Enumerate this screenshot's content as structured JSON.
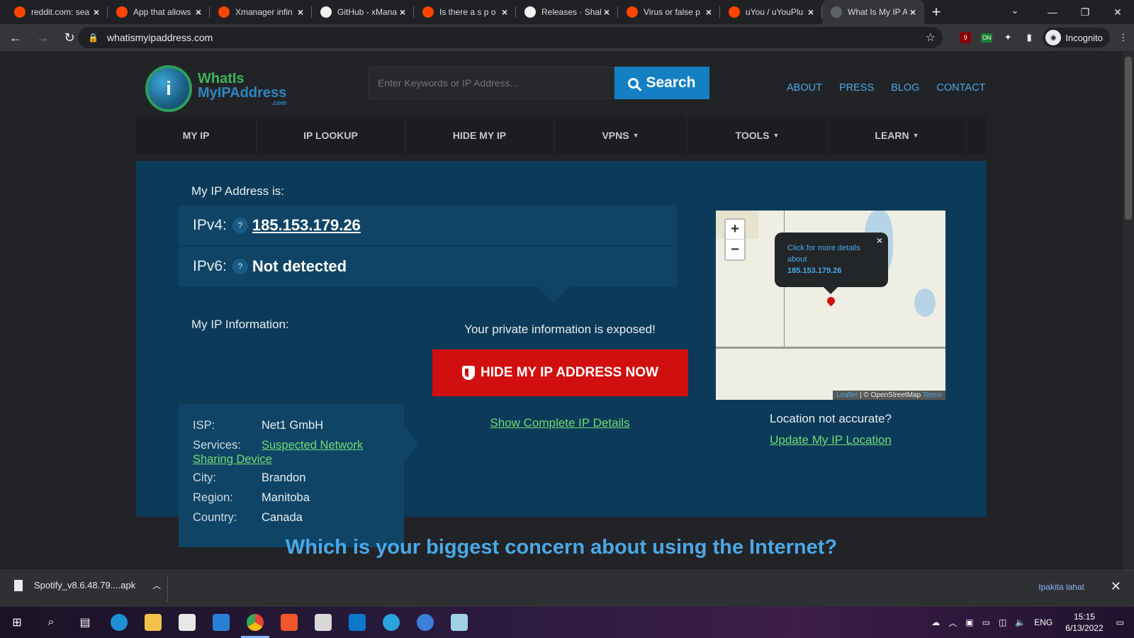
{
  "tabs": [
    {
      "title": "reddit.com: sea",
      "icon": "reddit"
    },
    {
      "title": "App that allows",
      "icon": "reddit"
    },
    {
      "title": "Xmanager infin",
      "icon": "reddit"
    },
    {
      "title": "GitHub - xMana",
      "icon": "github"
    },
    {
      "title": "Is there a s p o",
      "icon": "reddit"
    },
    {
      "title": "Releases · Shab",
      "icon": "github"
    },
    {
      "title": "Virus or false p",
      "icon": "reddit"
    },
    {
      "title": "uYou / uYouPlu",
      "icon": "reddit"
    },
    {
      "title": "What Is My IP A",
      "icon": "globe",
      "active": true
    }
  ],
  "browser": {
    "url": "whatismyipaddress.com",
    "profile": "Incognito",
    "ext_badge_count": "9",
    "ext_on_label": "ON"
  },
  "site": {
    "logo": {
      "line1": "WhatIs",
      "line2": "MyIPAddress",
      "suffix": ".com"
    },
    "search": {
      "placeholder": "Enter Keywords or IP Address...",
      "button": "Search"
    },
    "toplinks": [
      "ABOUT",
      "PRESS",
      "BLOG",
      "CONTACT"
    ],
    "nav": [
      {
        "label": "MY IP",
        "caret": false
      },
      {
        "label": "IP LOOKUP",
        "caret": false
      },
      {
        "label": "HIDE MY IP",
        "caret": false
      },
      {
        "label": "VPNS",
        "caret": true
      },
      {
        "label": "TOOLS",
        "caret": true
      },
      {
        "label": "LEARN",
        "caret": true
      }
    ],
    "caret": "▼"
  },
  "ip": {
    "heading": "My IP Address is:",
    "ipv4_label": "IPv4:",
    "ipv4_value": "185.153.179.26",
    "ipv6_label": "IPv6:",
    "ipv6_value": "Not detected",
    "help": "?"
  },
  "info": {
    "heading": "My IP Information:",
    "isp_label": "ISP:",
    "isp": "Net1 GmbH",
    "services_label": "Services:",
    "services_a": "Suspected Network",
    "services_b": "Sharing Device",
    "city_label": "City:",
    "city": "Brandon",
    "region_label": "Region:",
    "region": "Manitoba",
    "country_label": "Country:",
    "country": "Canada"
  },
  "cta": {
    "exposed": "Your private information is exposed!",
    "hide_button": "HIDE MY IP ADDRESS NOW",
    "details_link": "Show Complete IP Details"
  },
  "map": {
    "zoom_in": "+",
    "zoom_out": "−",
    "popup_line1": "Click for more details",
    "popup_line2": "about",
    "popup_ip": "185.153.179.26",
    "popup_close": "×",
    "attrib_leaflet": "Leaflet",
    "attrib_sep": " | © OpenStreetMap ",
    "attrib_terms": "Terms",
    "not_accurate": "Location not accurate?",
    "update_link": "Update My IP Location"
  },
  "concern_heading": "Which is your biggest concern about using the Internet?",
  "download": {
    "filename": "Spotify_v8.6.48.79....apk",
    "show_all": "Ipakita lahat"
  },
  "taskbar": {
    "lang": "ENG",
    "time": "15:15",
    "date": "6/13/2022"
  }
}
